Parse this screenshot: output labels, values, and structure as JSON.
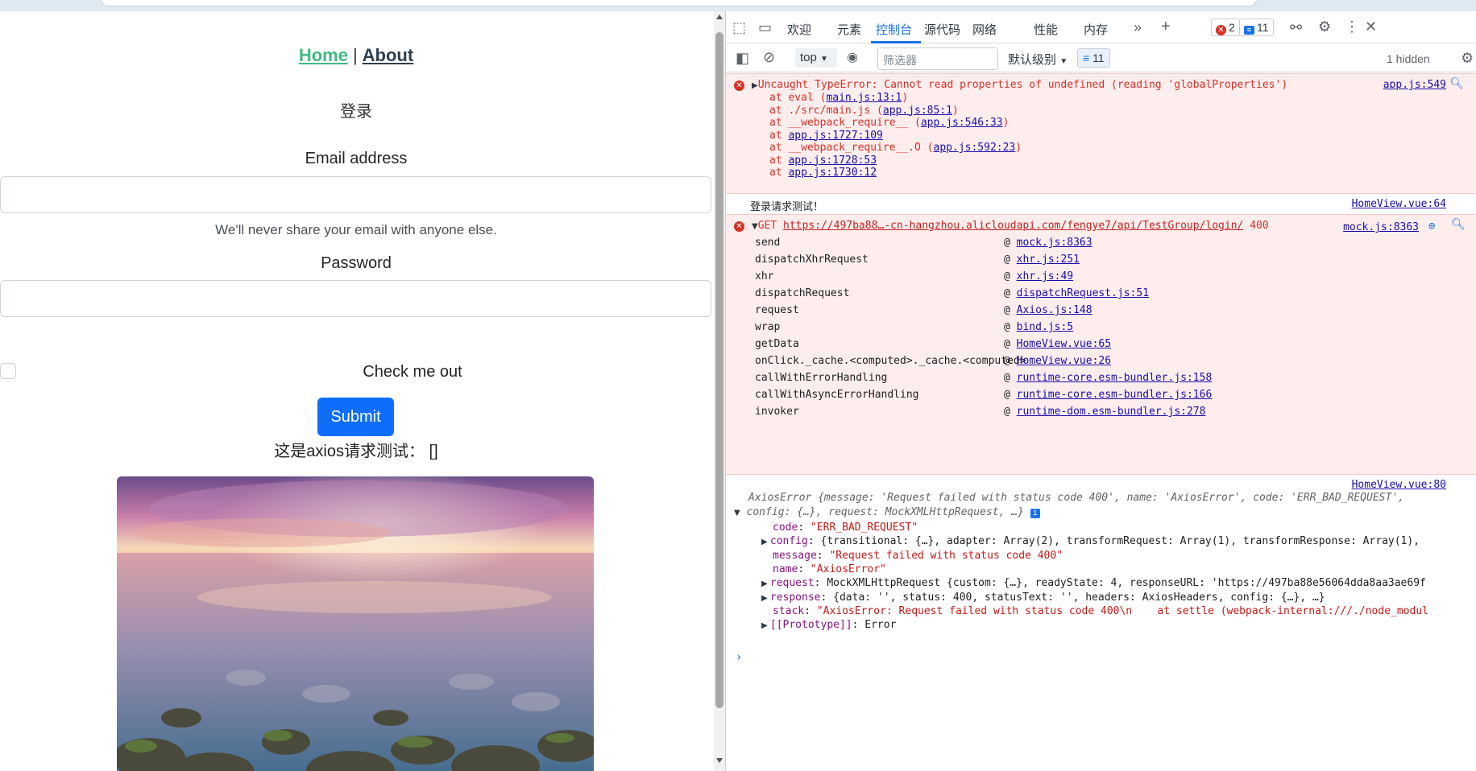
{
  "page": {
    "nav": {
      "home": "Home",
      "separator": "|",
      "about": "About"
    },
    "login_title": "登录",
    "email_label": "Email address",
    "email_help": "We'll never share your email with anyone else.",
    "password_label": "Password",
    "check_label": "Check me out",
    "submit_label": "Submit",
    "axios_line": "这是axios请求测试： []"
  },
  "devtools": {
    "tabs": [
      "欢迎",
      "元素",
      "控制台",
      "源代码",
      "网络",
      "性能",
      "内存"
    ],
    "active_tab": "控制台",
    "error_count": "2",
    "message_count": "11",
    "toolbar": {
      "context": "top",
      "filter_placeholder": "筛选器",
      "level": "默认级别",
      "messages": "11",
      "hidden": "1 hidden"
    },
    "console": {
      "error1": {
        "title": "Uncaught TypeError: Cannot read properties of undefined (reading 'globalProperties')",
        "source": "app.js:549",
        "stack": [
          {
            "pre": "at eval (",
            "link": "main.js:13:1",
            "post": ")"
          },
          {
            "pre": "at ./src/main.js (",
            "link": "app.js:85:1",
            "post": ")"
          },
          {
            "pre": "at __webpack_require__ (",
            "link": "app.js:546:33",
            "post": ")"
          },
          {
            "pre": "at ",
            "link": "app.js:1727:109",
            "post": ""
          },
          {
            "pre": "at __webpack_require__.O (",
            "link": "app.js:592:23",
            "post": ")"
          },
          {
            "pre": "at ",
            "link": "app.js:1728:53",
            "post": ""
          },
          {
            "pre": "at ",
            "link": "app.js:1730:12",
            "post": ""
          }
        ]
      },
      "log1": {
        "text": "登录请求测试！",
        "source": "HomeView.vue:64"
      },
      "error2": {
        "method": "GET",
        "url": "https://497ba88…-cn-hangzhou.alicloudapi.com/fengye7/api/TestGroup/login/",
        "status": "400",
        "source": "mock.js:8363",
        "frames": [
          {
            "fn": "send",
            "link": "mock.js:8363"
          },
          {
            "fn": "dispatchXhrRequest",
            "link": "xhr.js:251"
          },
          {
            "fn": "xhr",
            "link": "xhr.js:49"
          },
          {
            "fn": "dispatchRequest",
            "link": "dispatchRequest.js:51"
          },
          {
            "fn": "request",
            "link": "Axios.js:148"
          },
          {
            "fn": "wrap",
            "link": "bind.js:5"
          },
          {
            "fn": "getData",
            "link": "HomeView.vue:65"
          },
          {
            "fn": "onClick._cache.<computed>._cache.<computed>",
            "link": "HomeView.vue:26"
          },
          {
            "fn": "callWithErrorHandling",
            "link": "runtime-core.esm-bundler.js:158"
          },
          {
            "fn": "callWithAsyncErrorHandling",
            "link": "runtime-core.esm-bundler.js:166"
          },
          {
            "fn": "invoker",
            "link": "runtime-dom.esm-bundler.js:278"
          }
        ]
      },
      "log2": {
        "source": "HomeView.vue:80",
        "summary1": "AxiosError {message: 'Request failed with status code 400', name: 'AxiosError', code: 'ERR_BAD_REQUEST',",
        "summary2": "config: {…}, request: MockXMLHttpRequest, …}",
        "props": [
          {
            "k": "code",
            "v": "\"ERR_BAD_REQUEST\"",
            "expand": false
          },
          {
            "k": "config",
            "v": "{transitional: {…}, adapter: Array(2), transformRequest: Array(1), transformResponse: Array(1),",
            "expand": true
          },
          {
            "k": "message",
            "v": "\"Request failed with status code 400\"",
            "expand": false
          },
          {
            "k": "name",
            "v": "\"AxiosError\"",
            "expand": false
          },
          {
            "k": "request",
            "v": "MockXMLHttpRequest {custom: {…}, readyState: 4, responseURL: 'https://497ba88e56064dda8aa3ae69f",
            "expand": true
          },
          {
            "k": "response",
            "v": "{data: '', status: 400, statusText: '', headers: AxiosHeaders, config: {…}, …}",
            "expand": true
          },
          {
            "k": "stack",
            "v": "\"AxiosError: Request failed with status code 400\\n    at settle (webpack-internal:///./node_modul",
            "expand": false
          },
          {
            "k": "[[Prototype]]",
            "v": "Error",
            "expand": true
          }
        ]
      }
    }
  }
}
